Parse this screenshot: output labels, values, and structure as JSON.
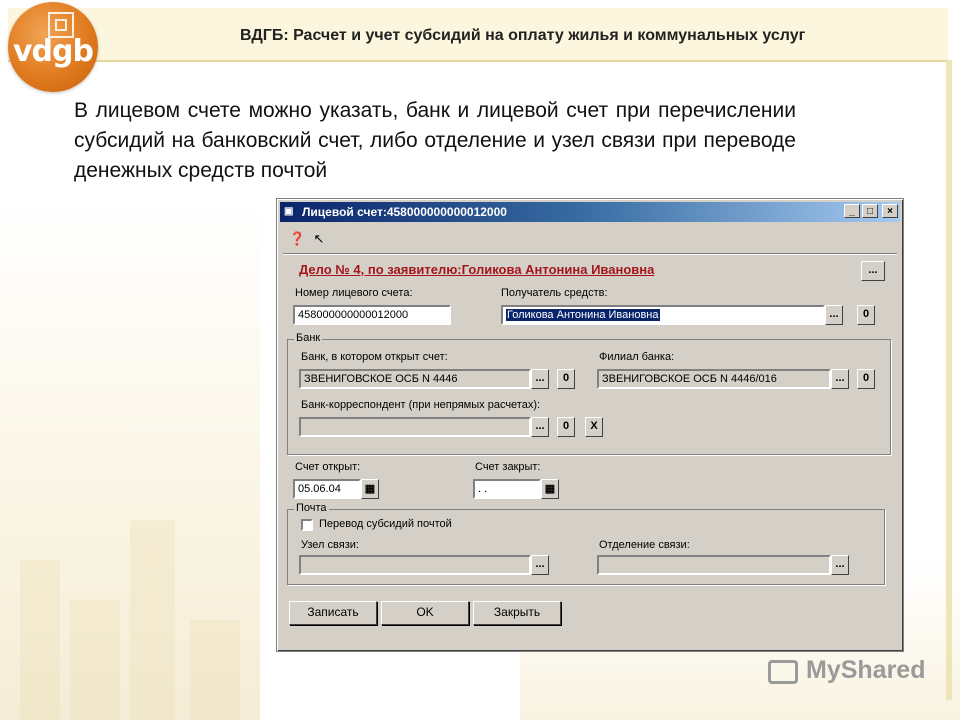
{
  "slide": {
    "title": "ВДГБ: Расчет и учет субсидий на оплату жилья и коммунальных услуг",
    "logo_text": "vdgb",
    "intro": "В лицевом счете можно указать, банк и лицевой счет при перечислении субсидий на банковский счет, либо отделение и узел связи при переводе денежных средств почтой",
    "watermark": "MyShared"
  },
  "window": {
    "title": "Лицевой счет:458000000000012000",
    "minimize": "_",
    "maximize": "□",
    "close": "×",
    "case_title": "Дело № 4, по заявителю:Голикова Антонина Ивановна",
    "case_button": "...",
    "account_label": "Номер лицевого счета:",
    "account_value": "458000000000012000",
    "recipient_label": "Получатель средств:",
    "recipient_value": "Голикова Антонина Ивановна",
    "bank_group": "Банк",
    "bank_label": "Банк, в котором открыт счет:",
    "bank_value": "ЗВЕНИГОВСКОЕ ОСБ N 4446",
    "branch_label": "Филиал банка:",
    "branch_value": "ЗВЕНИГОВСКОЕ ОСБ N 4446/016",
    "corr_label": "Банк-корреспондент (при непрямых расчетах):",
    "corr_value": "",
    "opened_label": "Счет открыт:",
    "opened_value": "05.06.04",
    "closed_label": "Счет закрыт:",
    "closed_value": " .  .",
    "post_group": "Почта",
    "post_checkbox_label": "Перевод субсидий почтой",
    "node_label": "Узел связи:",
    "office_label": "Отделение связи:",
    "btn_dots": "...",
    "btn_zero": "0",
    "btn_x": "X",
    "save_label": "Записать",
    "ok_label": "OK",
    "close_label": "Закрыть"
  }
}
